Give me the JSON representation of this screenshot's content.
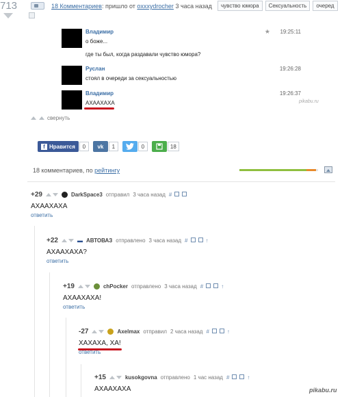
{
  "post": {
    "rating": "713",
    "comments_link": "18 Комментариев",
    "meta_middle": ": пришло от",
    "author": "oxxxydrocher",
    "time_ago": "3 часа назад",
    "tags": [
      "чувство юмора",
      "Сексуальность",
      "очеред"
    ]
  },
  "chat": {
    "messages": [
      {
        "name": "Владимир",
        "lines": [
          "о боже...",
          "где ты был, когда раздавали чувство юмора?"
        ],
        "time": "19:25:11"
      },
      {
        "name": "Руслан",
        "lines": [
          "стоял в очереди за сексуальностью"
        ],
        "time": "19:26:28"
      },
      {
        "name": "Владимир",
        "lines": [
          "АХААХАХА"
        ],
        "time": "19:26:37"
      }
    ],
    "watermark": "pikabu.ru"
  },
  "collapse_label": "свернуть",
  "share": {
    "like_label": "Нравится",
    "like_count": "0",
    "vk_label": "vk",
    "vk_count": "1",
    "tw_count": "0",
    "save_count": "18",
    "colors": {
      "fb": "#3b5998",
      "vk": "#4c75a3",
      "tw": "#55acee",
      "save": "#4cae4c"
    }
  },
  "sort": {
    "prefix": "18 комментариев, по",
    "link": "рейтингу"
  },
  "rating_bar": {
    "green": 0.85,
    "orange": 0.12
  },
  "comments": [
    {
      "score": "+29",
      "author": "DarkSpace3",
      "action": "отправил",
      "time": "3 часа назад",
      "text": "АХААХАХА",
      "reply": "ответить"
    },
    {
      "score": "+22",
      "author": "АВТОВАЗ",
      "action": "отправлено",
      "time": "3 часа назад",
      "text": "АХААХАХА?",
      "reply": "ответить"
    },
    {
      "score": "+19",
      "author": "chPocker",
      "action": "отправлено",
      "time": "3 часа назад",
      "text": "АХААХАХА!",
      "reply": "ответить"
    },
    {
      "score": "-27",
      "author": "Axelmax",
      "action": "отправил",
      "time": "2 часа назад",
      "text": "ХАХАХА, ХА!",
      "reply": "ответить"
    },
    {
      "score": "+15",
      "author": "kusokgovna",
      "action": "отправлено",
      "time": "1 час назад",
      "text": "АХААХАХА",
      "reply": ""
    }
  ],
  "footer_watermark": "pikabu.ru"
}
